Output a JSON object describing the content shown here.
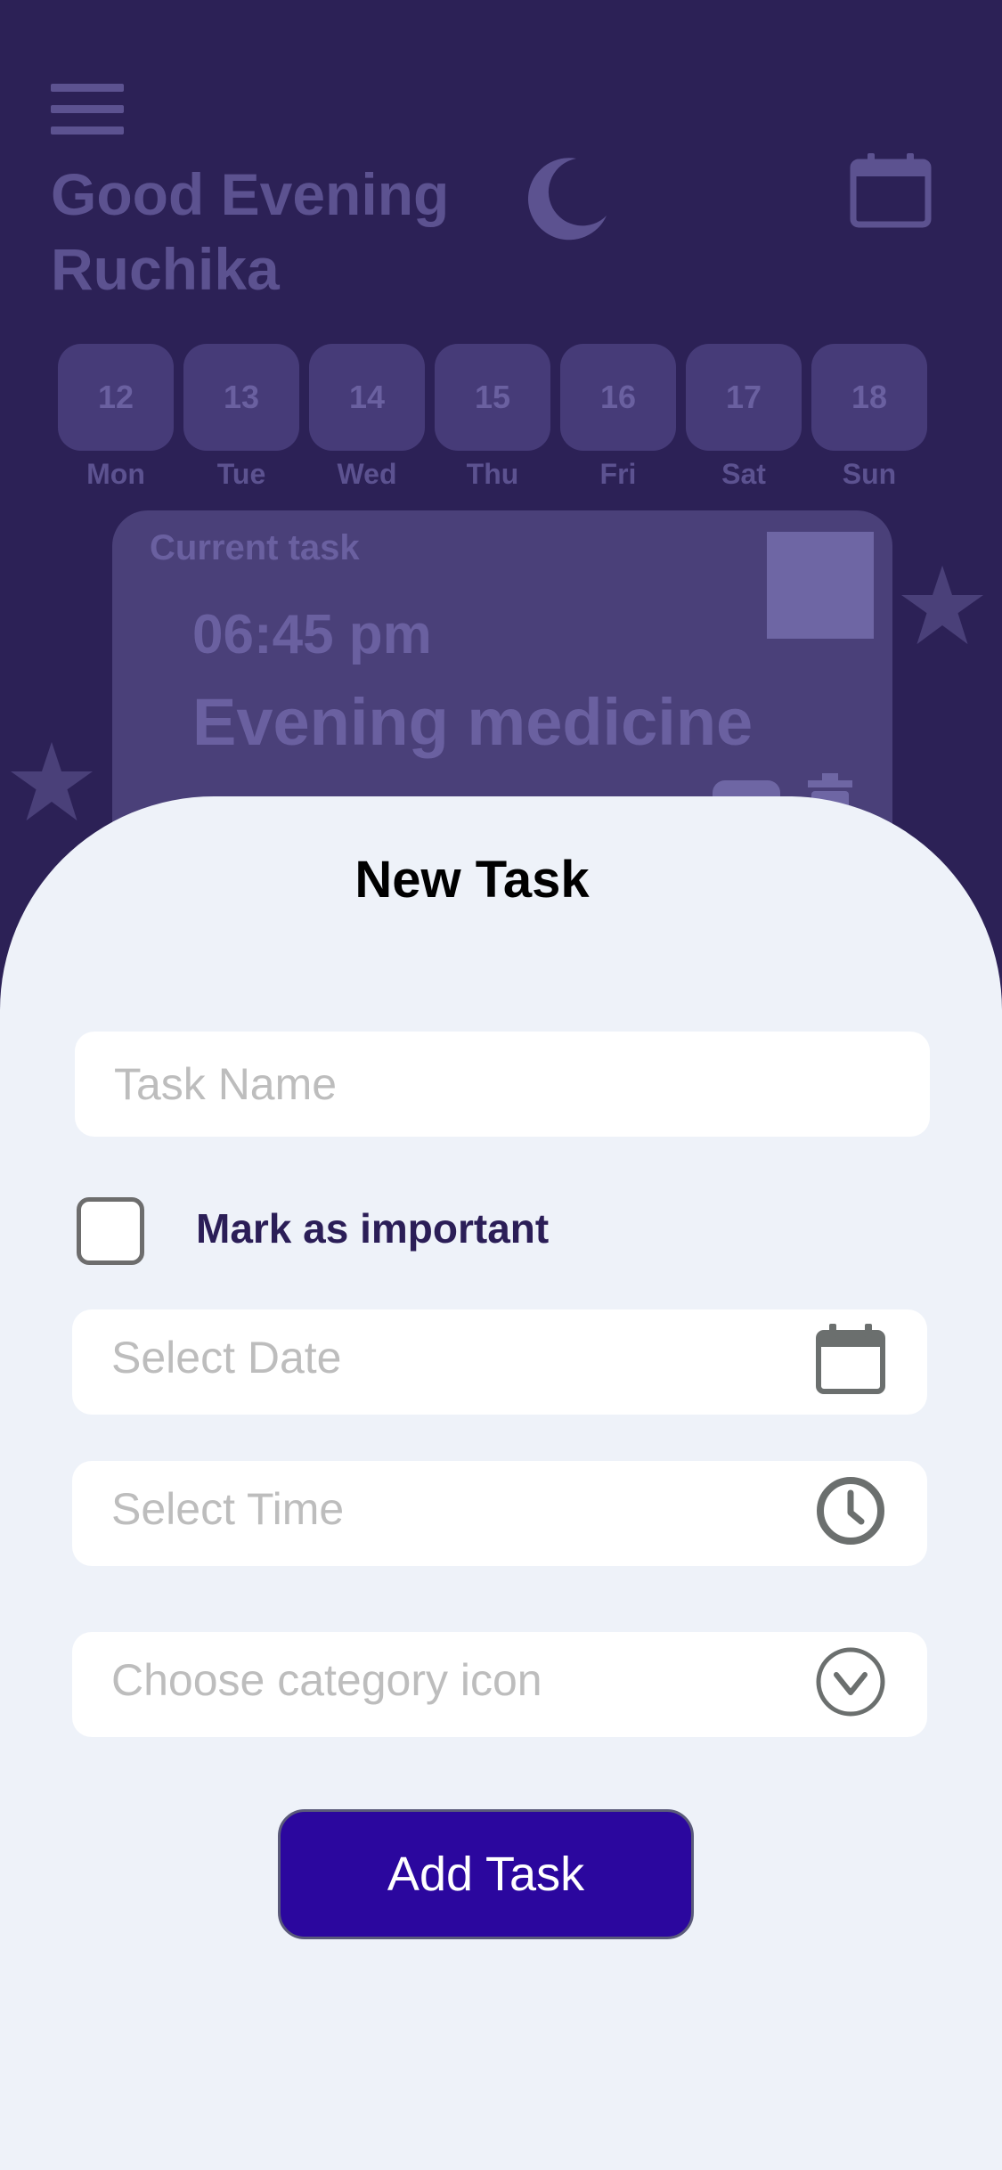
{
  "greeting": {
    "line1": "Good Evening",
    "line2": "Ruchika"
  },
  "days": [
    {
      "date": "12",
      "name": "Mon"
    },
    {
      "date": "13",
      "name": "Tue"
    },
    {
      "date": "14",
      "name": "Wed"
    },
    {
      "date": "15",
      "name": "Thu"
    },
    {
      "date": "16",
      "name": "Fri"
    },
    {
      "date": "17",
      "name": "Sat"
    },
    {
      "date": "18",
      "name": "Sun"
    }
  ],
  "current_task": {
    "label": "Current task",
    "time": "06:45 pm",
    "title": "Evening medicine"
  },
  "sheet": {
    "title": "New Task",
    "task_name_placeholder": "Task Name",
    "mark_important_label": "Mark as important",
    "mark_important_checked": false,
    "select_date_placeholder": "Select Date",
    "select_time_placeholder": "Select Time",
    "category_placeholder": "Choose category icon",
    "add_button_label": "Add Task"
  },
  "icons": {
    "menu": "hamburger-menu-icon",
    "moon": "moon-icon",
    "calendar": "calendar-icon",
    "clock": "clock-icon",
    "dropdown": "chevron-down-circle-icon",
    "trash": "trash-icon",
    "star": "star-icon"
  },
  "colors": {
    "background": "#2c2156",
    "sheet": "#eef2f9",
    "accent_button": "#2b079e",
    "label_text": "#2b1e57"
  }
}
